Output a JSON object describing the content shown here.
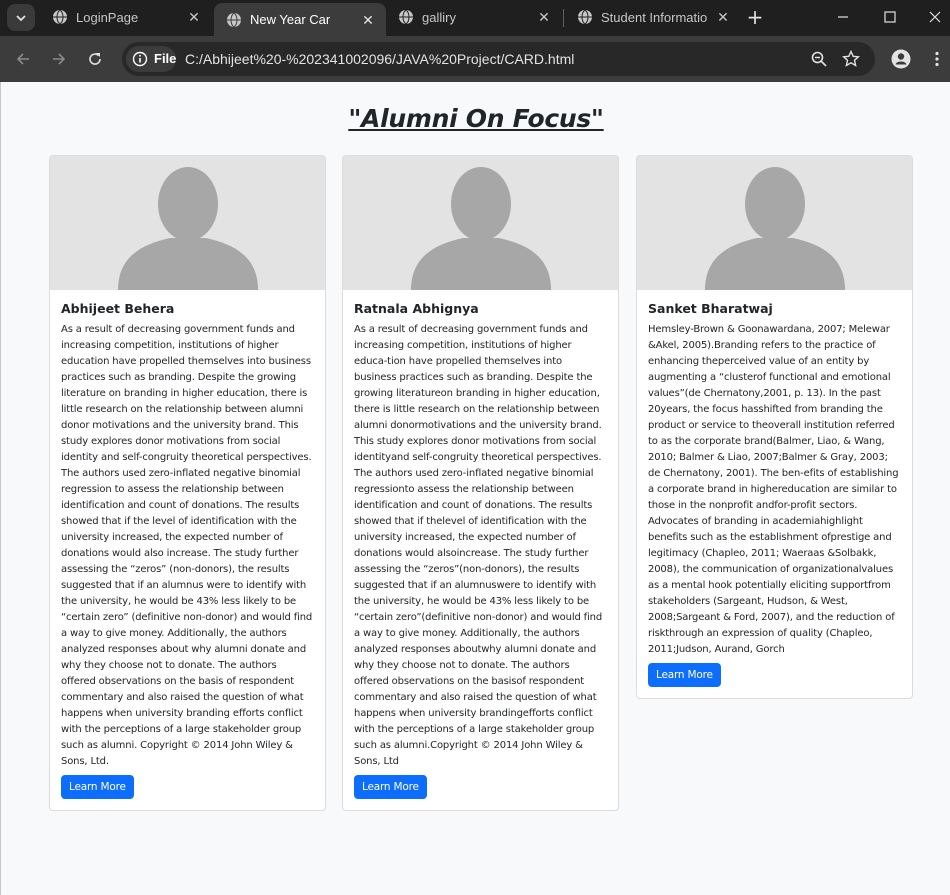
{
  "browser": {
    "tabs": [
      {
        "title": "LoginPage",
        "active": false
      },
      {
        "title": "New Year Card Gallery",
        "active": true
      },
      {
        "title": "galliry",
        "active": false
      },
      {
        "title": "Student Information",
        "active": false
      }
    ],
    "chip_label": "File",
    "url": "C:/Abhijeet%20-%202341002096/JAVA%20Project/CARD.html"
  },
  "page": {
    "title": "\"Alumni On Focus\"",
    "cards": [
      {
        "name": "Abhijeet Behera",
        "text": "As a result of decreasing government funds and increasing competition, institutions of higher education have propelled themselves into business practices such as branding. Despite the growing literature on branding in higher education, there is little research on the relationship between alumni donor motivations and the university brand. This study explores donor motivations from social identity and self-congruity theoretical perspectives. The authors used zero-inflated negative binomial regression to assess the relationship between identification and count of donations. The results showed that if the level of identification with the university increased, the expected number of donations would also increase. The study further assessing the “zeros” (non-donors), the results suggested that if an alumnus were to identify with the university, he would be 43% less likely to be “certain zero” (definitive non-donor) and would find a way to give money. Additionally, the authors analyzed responses about why alumni donate and why they choose not to donate. The authors offered observations on the basis of respondent commentary and also raised the question of what happens when university branding efforts conflict with the perceptions of a large stakeholder group such as alumni. Copyright © 2014 John Wiley & Sons, Ltd.",
        "button": "Learn More"
      },
      {
        "name": "Ratnala Abhignya",
        "text": "As a result of decreasing government funds and increasing competition, institutions of higher educa-tion have propelled themselves into business practices such as branding. Despite the growing literatureon branding in higher education, there is little research on the relationship between alumni donormotivations and the university brand. This study explores donor motivations from social identityand self-congruity theoretical perspectives. The authors used zero-inflated negative binomial regressionto assess the relationship between identification and count of donations. The results showed that if thelevel of identification with the university increased, the expected number of donations would alsoincrease. The study further assessing the “zeros”(non-donors), the results suggested that if an alumnuswere to identify with the university, he would be 43% less likely to be “certain zero”(definitive non-donor) and would find a way to give money. Additionally, the authors analyzed responses aboutwhy alumni donate and why they choose not to donate. The authors offered observations on the basisof respondent commentary and also raised the question of what happens when university brandingefforts conflict with the perceptions of a large stakeholder group such as alumni.Copyright © 2014 John Wiley & Sons, Ltd",
        "button": "Learn More"
      },
      {
        "name": "Sanket Bharatwaj",
        "text": "Hemsley-Brown & Goonawardana, 2007; Melewar &Akel, 2005).Branding refers to the practice of enhancing theperceived value of an entity by augmenting a “clusterof functional and emotional values”(de Chernatony,2001, p. 13). In the past 20years, the focus hasshifted from branding the product or service to theoverall institution referred to as the corporate brand(Balmer, Liao, & Wang, 2010; Balmer & Liao, 2007;Balmer & Gray, 2003; de Chernatony, 2001). The ben-efits of establishing a corporate brand in highereducation are similar to those in the nonprofit andfor-profit sectors. Advocates of branding in academiahighlight benefits such as the establishment ofprestige and legitimacy (Chapleo, 2011; Waeraas &Solbakk, 2008), the communication of organizationalvalues as a mental hook potentially eliciting supportfrom stakeholders (Sargeant, Hudson, & West, 2008;Sargeant & Ford, 2007), and the reduction of riskthrough an expression of quality (Chapleo, 2011;Judson, Aurand, Gorch",
        "button": "Learn More"
      }
    ]
  },
  "colors": {
    "accent": "#0d6efd",
    "tabstrip": "#1f1f1f",
    "toolbar": "#3c3c3c",
    "page_bg": "#f8f9fa",
    "placeholder_bg": "#e3e3e3",
    "silhouette": "#a7a7a7"
  },
  "icons": [
    "tab-search-icon",
    "globe-icon",
    "close-icon",
    "plus-icon",
    "minimize-icon",
    "maximize-icon",
    "window-close-icon",
    "back-arrow-icon",
    "forward-arrow-icon",
    "reload-icon",
    "info-icon",
    "zoom-icon",
    "star-icon",
    "profile-icon",
    "menu-dots-icon",
    "person-silhouette-icon"
  ]
}
